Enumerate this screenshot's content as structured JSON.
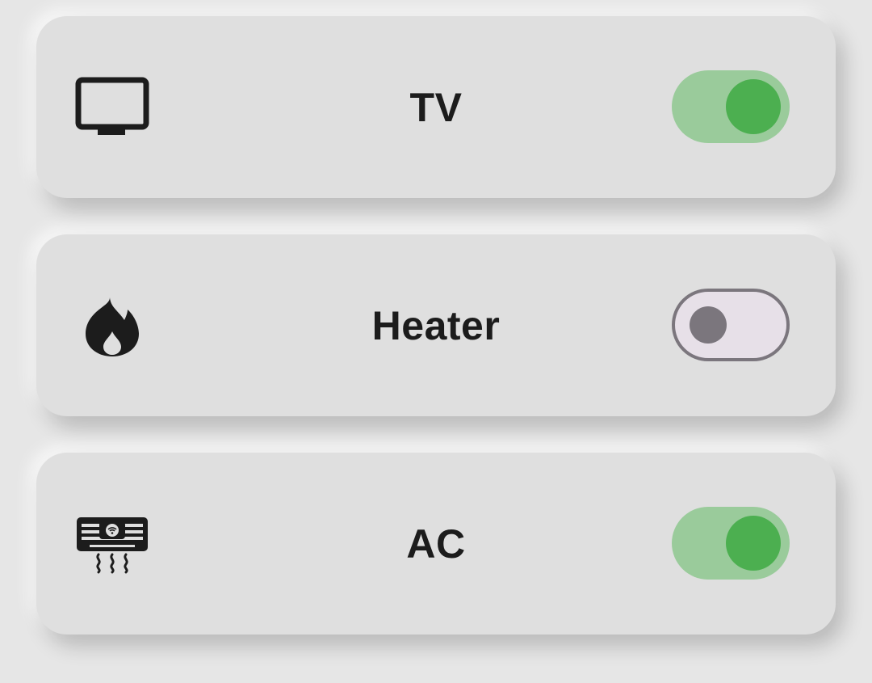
{
  "devices": [
    {
      "label": "TV",
      "icon": "tv-icon",
      "state": "on"
    },
    {
      "label": "Heater",
      "icon": "flame-icon",
      "state": "off"
    },
    {
      "label": "AC",
      "icon": "air-conditioner-icon",
      "state": "on"
    }
  ],
  "colors": {
    "background": "#e6e6e6",
    "card": "#dfdfdf",
    "text": "#1c1c1c",
    "toggle_on_track": "#9acb9b",
    "toggle_on_knob": "#4caf50",
    "toggle_off_track": "#e7e0e8",
    "toggle_off_outline": "#7b767d"
  }
}
